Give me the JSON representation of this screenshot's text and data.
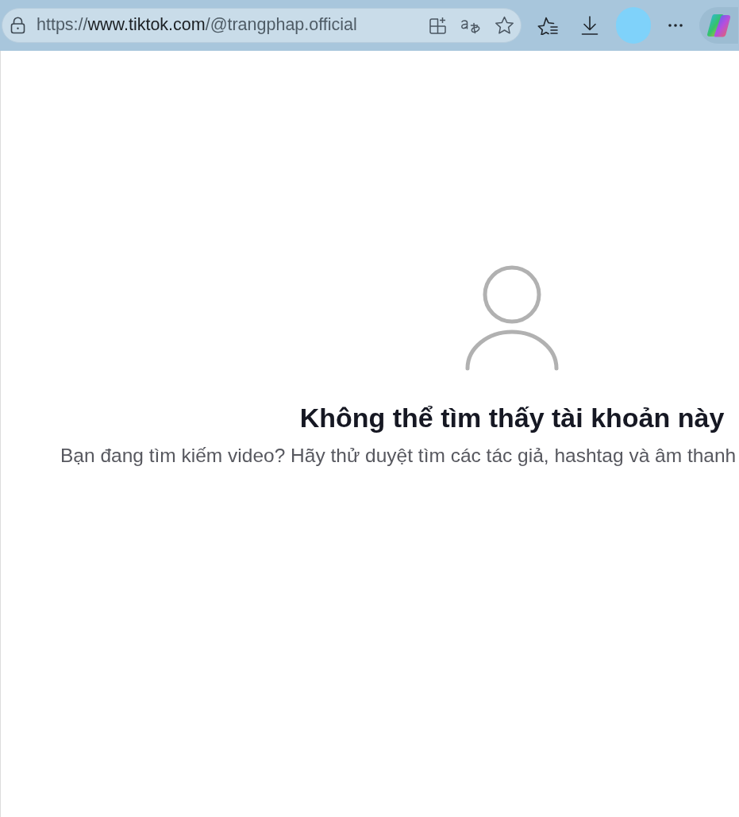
{
  "browser": {
    "address_bar": {
      "url_scheme": "https://",
      "url_host": "www.tiktok.com",
      "url_path": "/@trangphap.official"
    }
  },
  "page": {
    "title": "Không thể tìm thấy tài khoản này",
    "message": "Bạn đang tìm kiếm video? Hãy thử duyệt tìm các tác giả, hashtag và âm thanh"
  }
}
